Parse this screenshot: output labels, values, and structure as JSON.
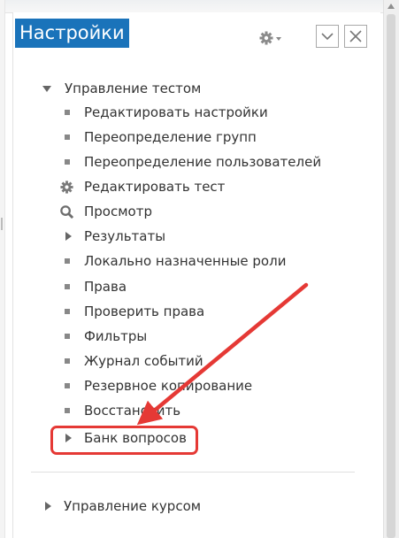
{
  "block": {
    "title": "Настройки",
    "icons": {
      "gear": "gear-menu-icon",
      "collapse": "collapse-icon",
      "close": "close-icon"
    }
  },
  "tree": {
    "quiz_admin": {
      "label": "Управление тестом",
      "state": "expanded",
      "items": [
        {
          "label": "Редактировать настройки",
          "icon": "bullet"
        },
        {
          "label": "Переопределение групп",
          "icon": "bullet"
        },
        {
          "label": "Переопределение пользователей",
          "icon": "bullet"
        },
        {
          "label": "Редактировать тест",
          "icon": "gear-icon"
        },
        {
          "label": "Просмотр",
          "icon": "magnifier-icon"
        },
        {
          "label": "Результаты",
          "icon": "triangle-right"
        },
        {
          "label": "Локально назначенные роли",
          "icon": "bullet"
        },
        {
          "label": "Права",
          "icon": "bullet"
        },
        {
          "label": "Проверить права",
          "icon": "bullet"
        },
        {
          "label": "Фильтры",
          "icon": "bullet"
        },
        {
          "label": "Журнал событий",
          "icon": "bullet"
        },
        {
          "label": "Резервное копирование",
          "icon": "bullet"
        },
        {
          "label": "Восстановить",
          "icon": "bullet"
        },
        {
          "label": "Банк вопросов",
          "icon": "triangle-right"
        }
      ]
    },
    "course_admin": {
      "label": "Управление курсом",
      "state": "collapsed"
    }
  },
  "annotation": {
    "color": "#e53935",
    "target": "Банк вопросов"
  },
  "colors": {
    "title_bg": "#1a73ba",
    "title_text": "#ffffff",
    "text": "#333333"
  }
}
